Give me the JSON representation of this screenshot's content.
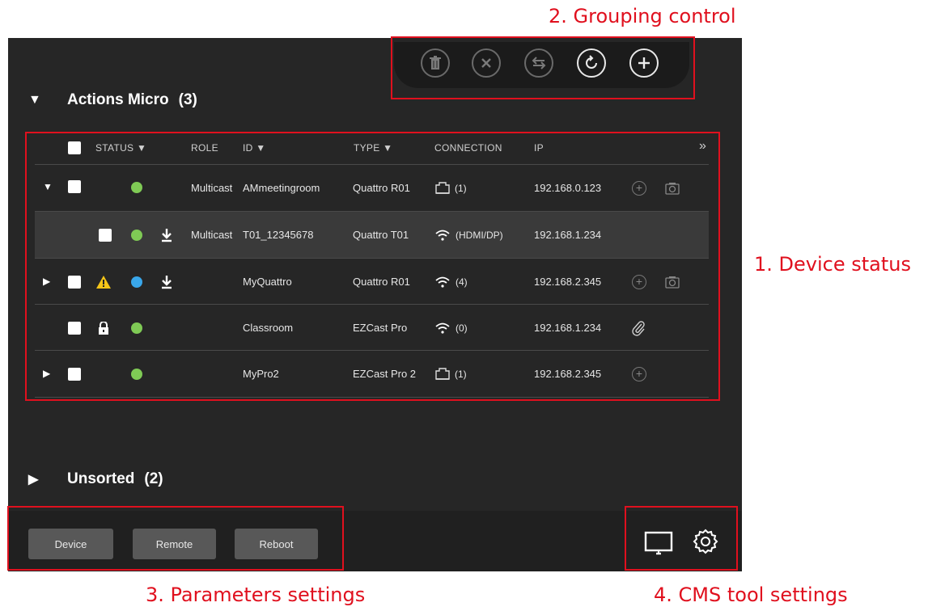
{
  "annotations": {
    "grouping": "2. Grouping control",
    "device_status": "1. Device status",
    "parameters": "3. Parameters settings",
    "cms": "4. CMS tool settings"
  },
  "groups": {
    "actions_micro": {
      "name": "Actions Micro",
      "count": "(3)"
    },
    "unsorted": {
      "name": "Unsorted",
      "count": "(2)"
    }
  },
  "toolbar": {
    "buttons": [
      "trash-icon",
      "close-icon",
      "swap-icon",
      "refresh-icon",
      "add-icon"
    ]
  },
  "table": {
    "headers": {
      "status": "STATUS ▼",
      "role": "ROLE",
      "id": "ID ▼",
      "type": "TYPE ▼",
      "connection": "CONNECTION",
      "ip": "IP",
      "more": "»"
    },
    "rows": [
      {
        "role": "Multicast",
        "id": "AMmeetingroom",
        "type": "Quattro R01",
        "conn": "(1)",
        "ip": "192.168.0.123"
      },
      {
        "role": "Multicast",
        "id": "T01_12345678",
        "type": "Quattro T01",
        "conn": "(HDMI/DP)",
        "ip": "192.168.1.234"
      },
      {
        "role": "",
        "id": "MyQuattro",
        "type": "Quattro R01",
        "conn": "(4)",
        "ip": "192.168.2.345"
      },
      {
        "role": "",
        "id": "Classroom",
        "type": "EZCast Pro",
        "conn": "(0)",
        "ip": "192.168.1.234"
      },
      {
        "role": "",
        "id": "MyPro2",
        "type": "EZCast Pro 2",
        "conn": "(1)",
        "ip": "192.168.2.345"
      }
    ]
  },
  "bottom": {
    "device": "Device",
    "remote": "Remote",
    "reboot": "Reboot"
  },
  "colors": {
    "panel": "#262626",
    "annotation": "#e0101e",
    "status_green": "#7fca55",
    "status_blue": "#39a7ea",
    "warning": "#f5c518"
  }
}
